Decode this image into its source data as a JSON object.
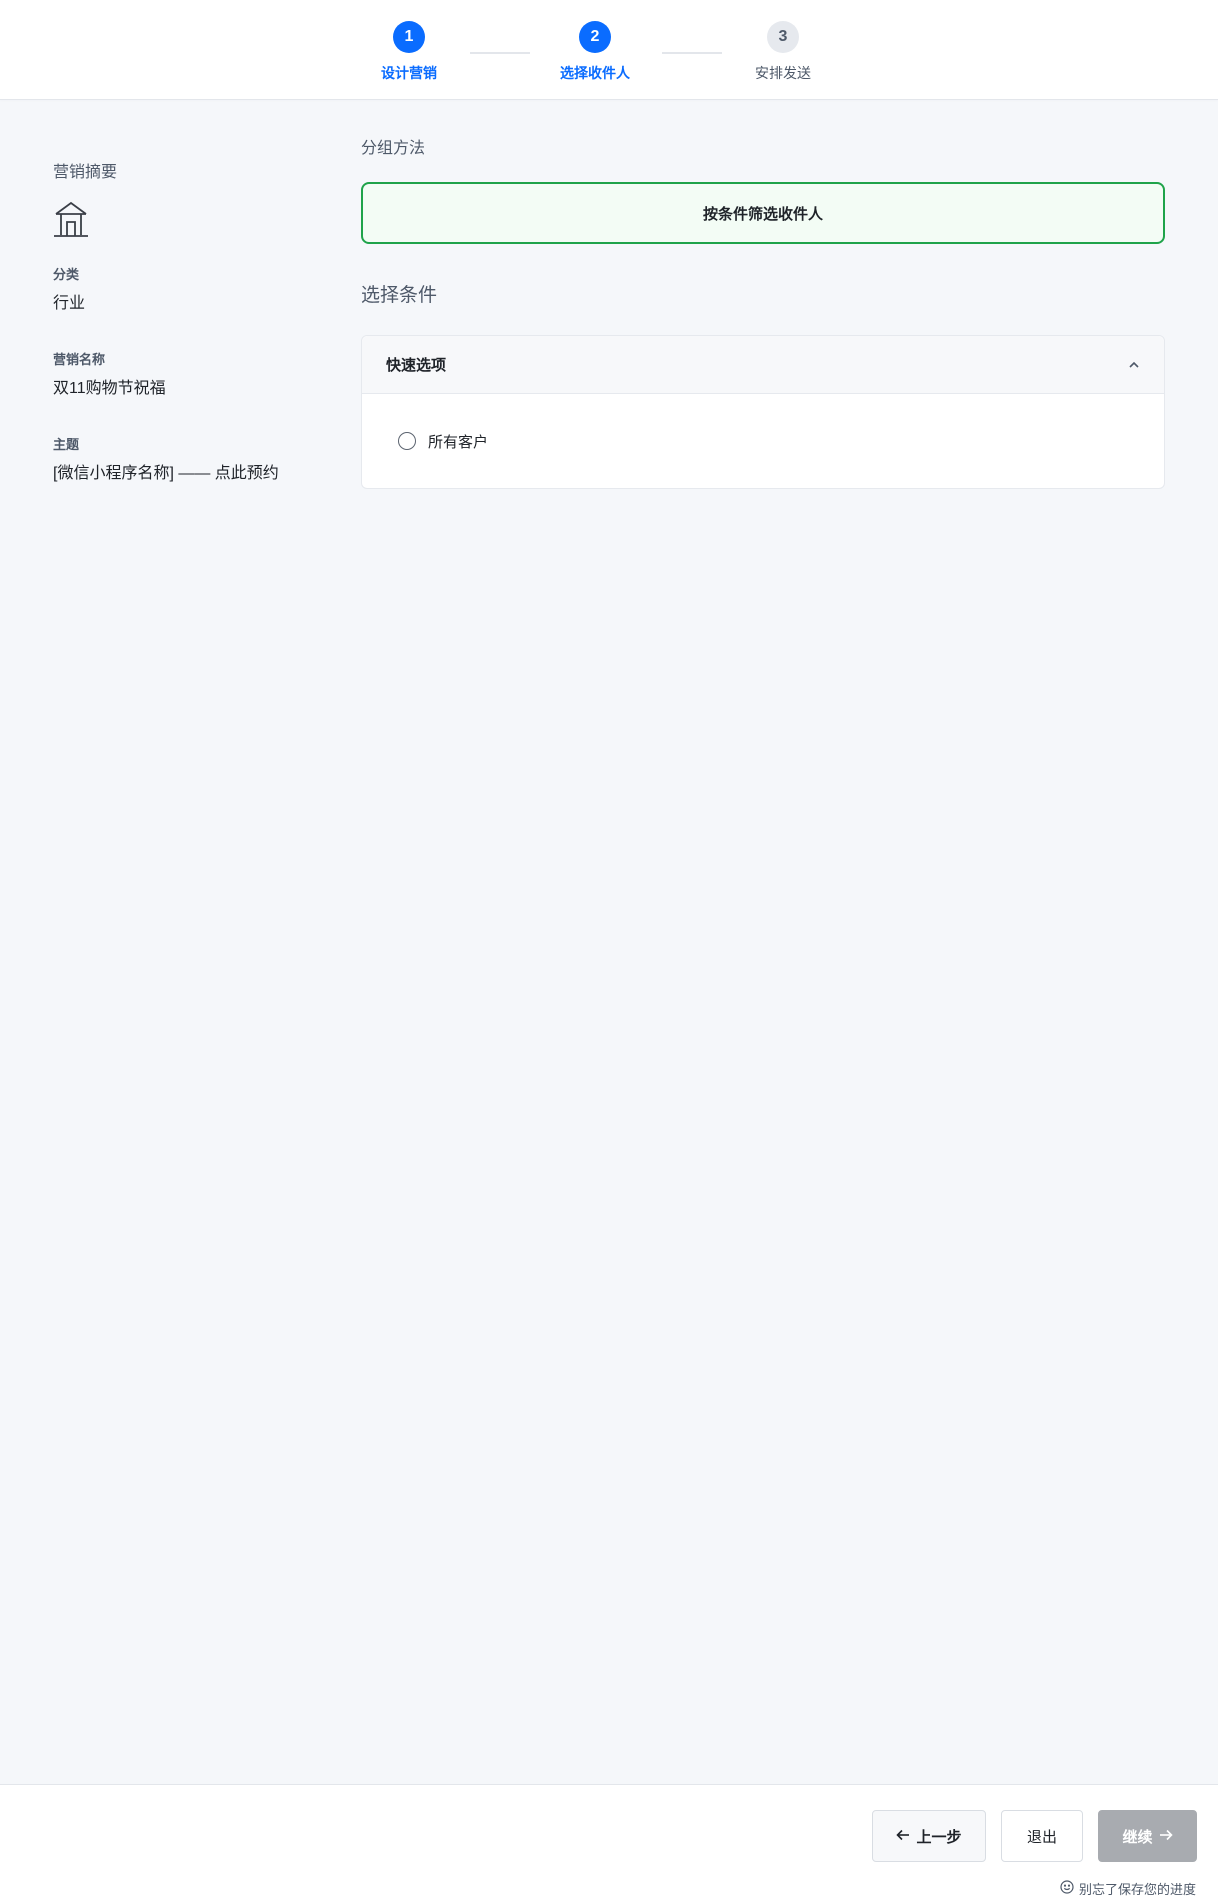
{
  "stepper": {
    "steps": [
      {
        "number": "1",
        "label": "设计营销",
        "state": "active"
      },
      {
        "number": "2",
        "label": "选择收件人",
        "state": "active"
      },
      {
        "number": "3",
        "label": "安排发送",
        "state": "inactive"
      }
    ]
  },
  "summary": {
    "title": "营销摘要",
    "icon": "building-icon",
    "category_label": "分类",
    "category_value": "行业",
    "name_label": "营销名称",
    "name_value": "双11购物节祝福",
    "subject_label": "主题",
    "subject_value": "[微信小程序名称] —— 点此预约"
  },
  "main": {
    "group_method_label": "分组方法",
    "group_method_option": "按条件筛选收件人",
    "conditions_heading": "选择条件",
    "quick_options": {
      "title": "快速选项",
      "items": [
        {
          "label": "所有客户",
          "checked": false
        }
      ]
    }
  },
  "footer": {
    "prev_label": "上一步",
    "exit_label": "退出",
    "next_label": "继续",
    "save_hint": "别忘了保存您的进度"
  },
  "colors": {
    "accent": "#0a6cff",
    "selected_border": "#1fa34a",
    "selected_bg": "#f3fcf5",
    "disabled_button": "#a8abb0"
  }
}
